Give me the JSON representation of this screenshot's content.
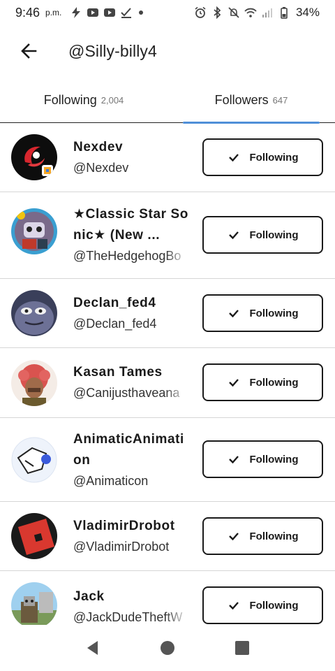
{
  "status_bar": {
    "time": "9:46",
    "ampm": "p.m.",
    "battery": "34%"
  },
  "header": {
    "title": "@Silly-billy4"
  },
  "tabs": [
    {
      "label": "Following",
      "count": "2,004",
      "active": false
    },
    {
      "label": "Followers",
      "count": "647",
      "active": true
    }
  ],
  "users": [
    {
      "display_name": "Nexdev",
      "handle": "@Nexdev",
      "button": "Following",
      "avatar": "nexdev-avatar"
    },
    {
      "display_name": "★Classic Star Sonic★ (New ...",
      "handle": "@TheHedgehogBo",
      "button": "Following",
      "avatar": "sonic-avatar"
    },
    {
      "display_name": "Declan_fed4",
      "handle": "@Declan_fed4",
      "button": "Following",
      "avatar": "declan-avatar"
    },
    {
      "display_name": "Kasan Tames",
      "handle": "@Canijusthaveana",
      "button": "Following",
      "avatar": "kasan-avatar"
    },
    {
      "display_name": "AnimaticAnimation",
      "handle": "@Animaticon",
      "button": "Following",
      "avatar": "animatic-avatar"
    },
    {
      "display_name": "VladimirDrobot",
      "handle": "@VladimirDrobot",
      "button": "Following",
      "avatar": "vladimir-avatar"
    },
    {
      "display_name": "Jack",
      "handle": "@JackDudeTheftW",
      "button": "Following",
      "avatar": "jack-avatar"
    }
  ],
  "nav": {
    "back": "back-triangle-icon",
    "home": "home-circle-icon",
    "recents": "recents-square-icon"
  },
  "colors": {
    "tab_indicator": "#4f8fd8",
    "text": "#1a1a1a",
    "divider": "#d6d6d6"
  }
}
